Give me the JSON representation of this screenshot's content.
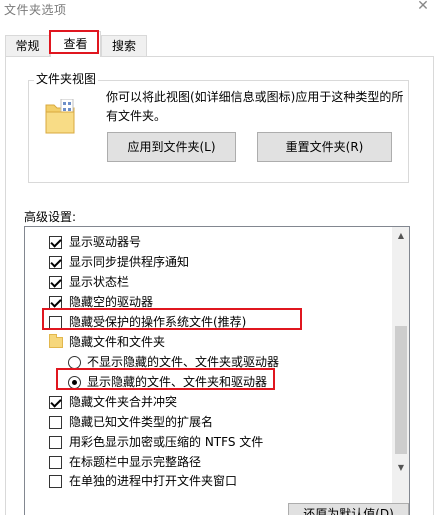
{
  "window": {
    "title": "文件夹选项"
  },
  "tabs": [
    {
      "label": "常规",
      "active": false
    },
    {
      "label": "查看",
      "active": true
    },
    {
      "label": "搜索",
      "active": false
    }
  ],
  "folder_views": {
    "legend": "文件夹视图",
    "description": "你可以将此视图(如详细信息或图标)应用于这种类型的所有文件夹。",
    "apply_button": "应用到文件夹(L)",
    "reset_button": "重置文件夹(R)"
  },
  "advanced": {
    "label": "高级设置:",
    "items": [
      {
        "type": "checkbox",
        "checked": true,
        "indent": 0,
        "label": "显示驱动器号"
      },
      {
        "type": "checkbox",
        "checked": true,
        "indent": 0,
        "label": "显示同步提供程序通知"
      },
      {
        "type": "checkbox",
        "checked": true,
        "indent": 0,
        "label": "显示状态栏"
      },
      {
        "type": "checkbox",
        "checked": true,
        "indent": 0,
        "label": "隐藏空的驱动器"
      },
      {
        "type": "checkbox",
        "checked": false,
        "indent": 0,
        "label": "隐藏受保护的操作系统文件(推荐)"
      },
      {
        "type": "folder",
        "indent": 0,
        "label": "隐藏文件和文件夹"
      },
      {
        "type": "radio",
        "checked": false,
        "indent": 1,
        "label": "不显示隐藏的文件、文件夹或驱动器"
      },
      {
        "type": "radio",
        "checked": true,
        "indent": 1,
        "label": "显示隐藏的文件、文件夹和驱动器"
      },
      {
        "type": "checkbox",
        "checked": true,
        "indent": 0,
        "label": "隐藏文件夹合并冲突"
      },
      {
        "type": "checkbox",
        "checked": false,
        "indent": 0,
        "label": "隐藏已知文件类型的扩展名"
      },
      {
        "type": "checkbox",
        "checked": false,
        "indent": 0,
        "label": "用彩色显示加密或压缩的 NTFS 文件"
      },
      {
        "type": "checkbox",
        "checked": false,
        "indent": 0,
        "label": "在标题栏中显示完整路径"
      },
      {
        "type": "checkbox",
        "checked": false,
        "indent": 0,
        "label": "在单独的进程中打开文件夹窗口"
      }
    ]
  },
  "footer": {
    "restore_button": "还原为默认值(D)"
  },
  "colors": {
    "highlight_red": "#e0161f"
  }
}
